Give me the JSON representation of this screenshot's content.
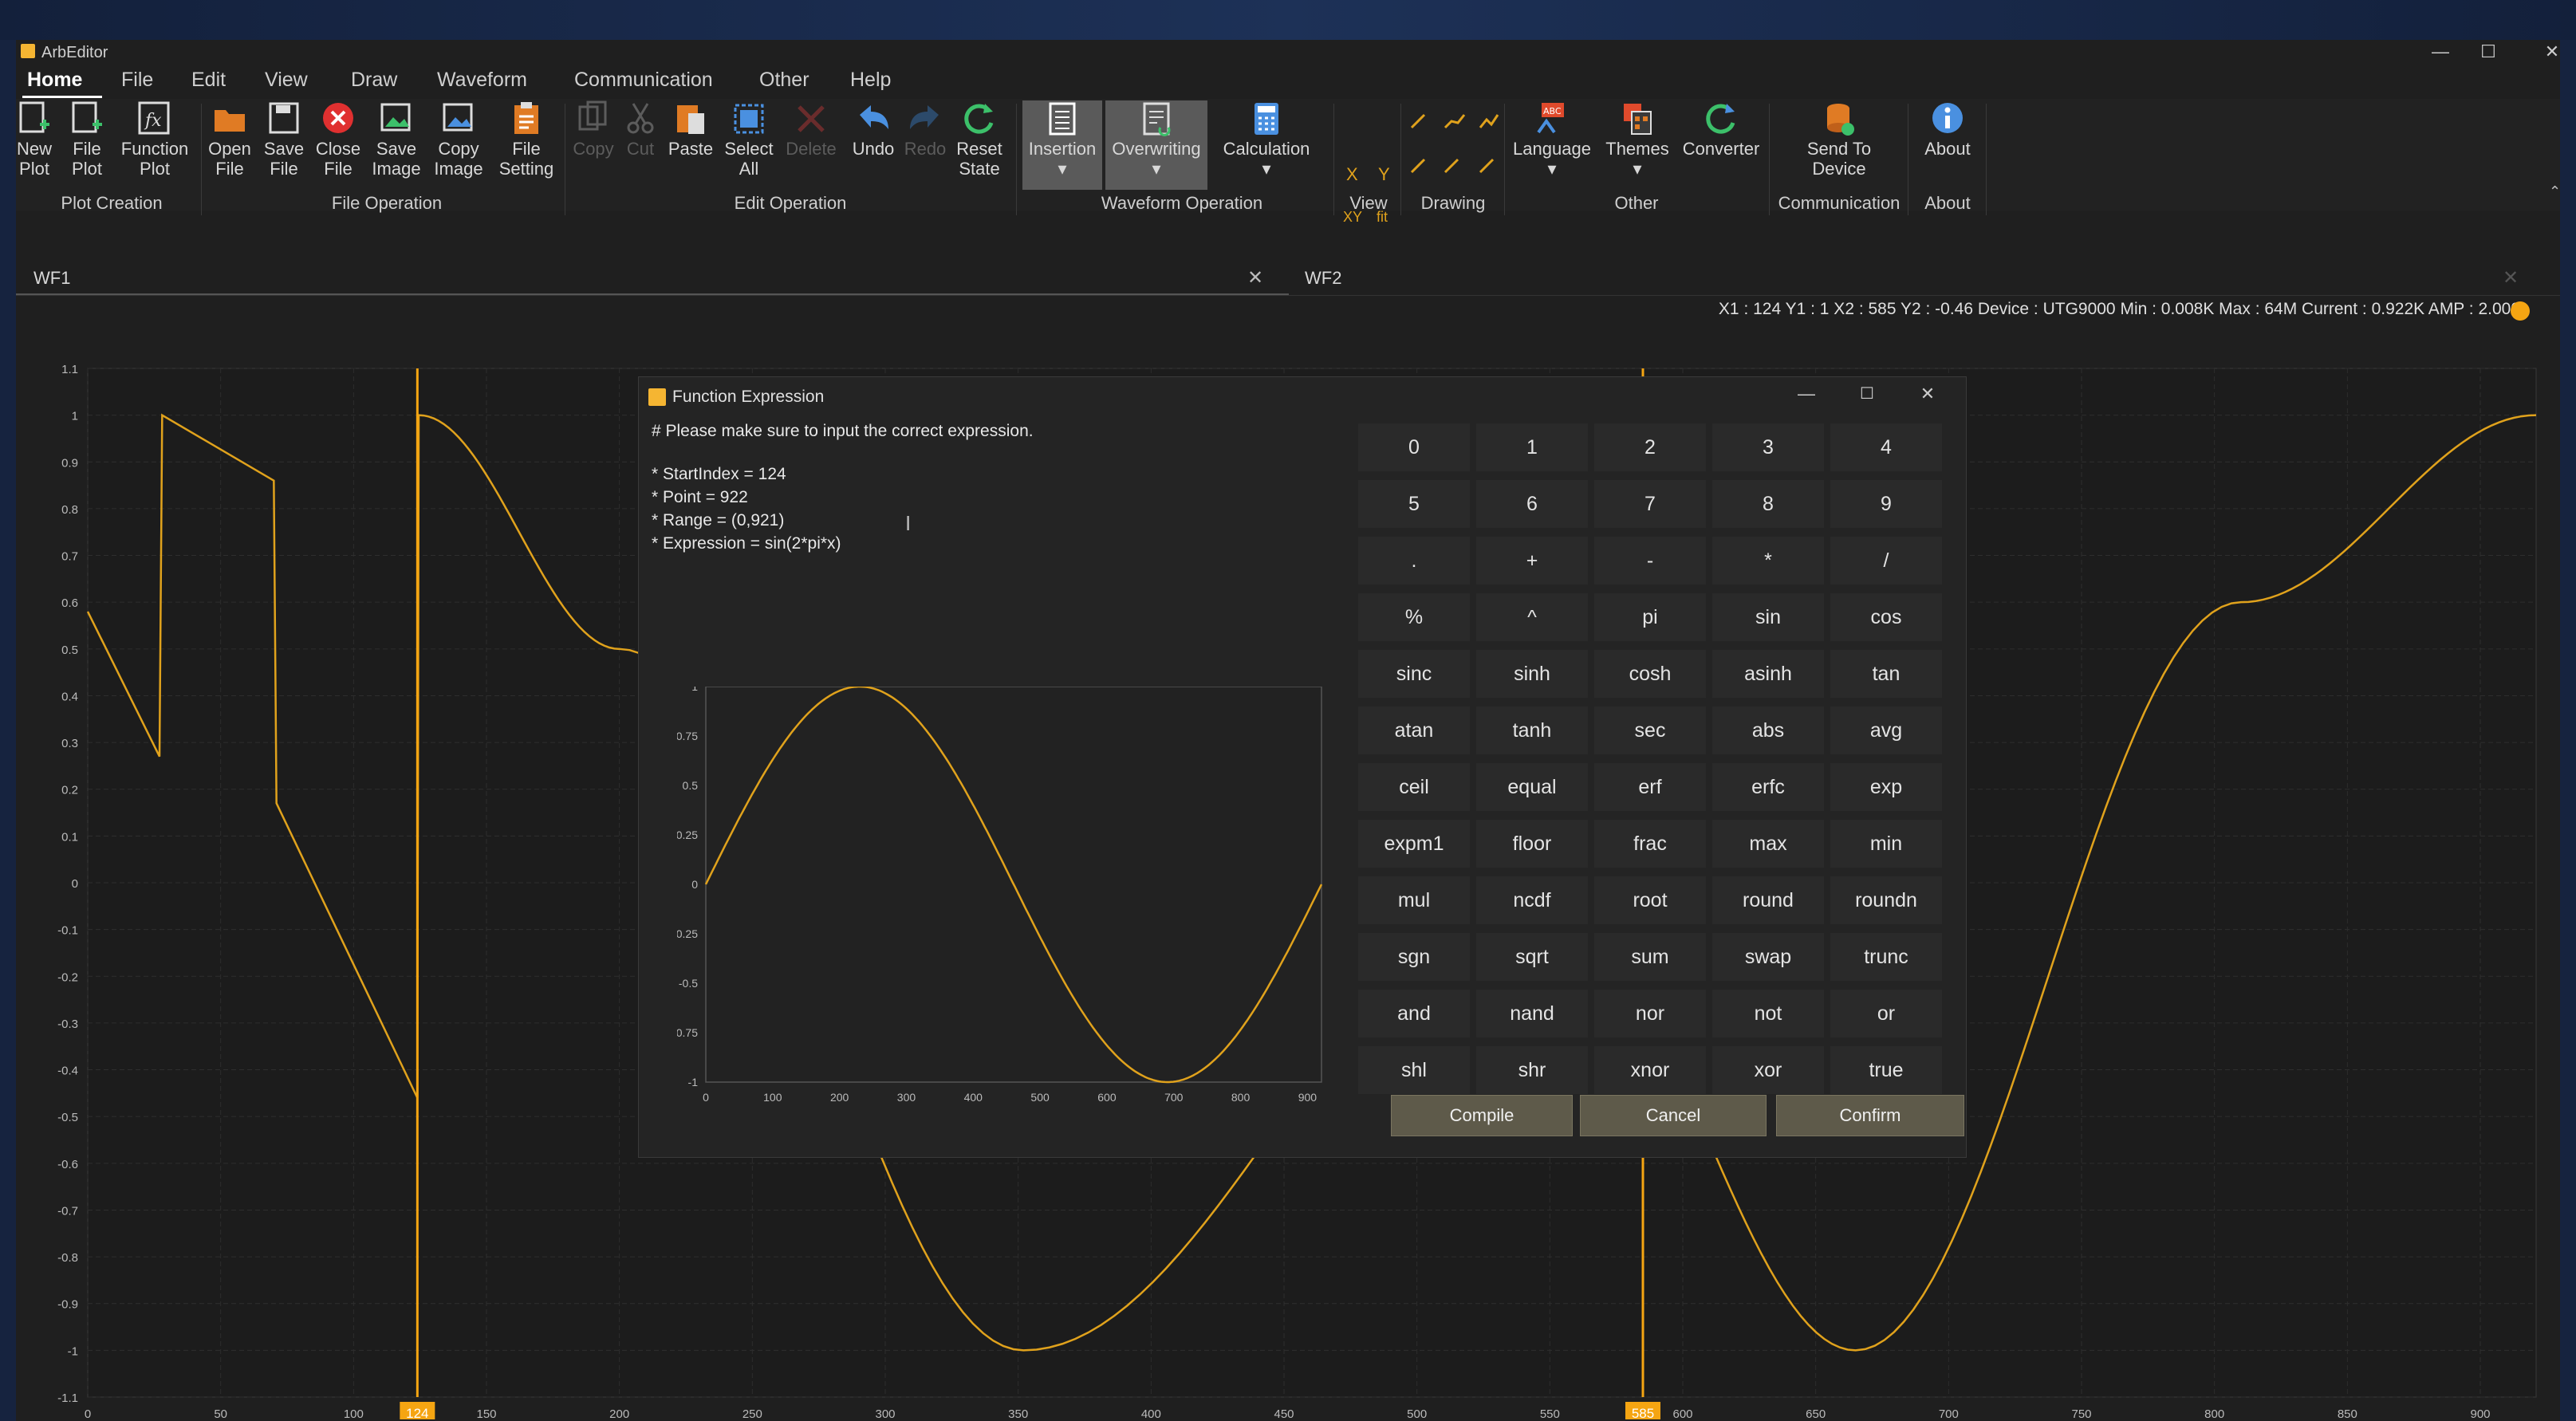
{
  "window": {
    "title": "ArbEditor"
  },
  "menu": [
    "Home",
    "File",
    "Edit",
    "View",
    "Draw",
    "Waveform",
    "Communication",
    "Other",
    "Help"
  ],
  "ribbon": {
    "buttons": [
      {
        "l1": "New",
        "l2": "Plot",
        "icon": "new-plot-icon"
      },
      {
        "l1": "File",
        "l2": "Plot",
        "icon": "file-plot-icon"
      },
      {
        "l1": "Function",
        "l2": "Plot",
        "icon": "function-plot-icon"
      },
      {
        "l1": "Open",
        "l2": "File",
        "icon": "open-folder-icon"
      },
      {
        "l1": "Save",
        "l2": "File",
        "icon": "save-icon"
      },
      {
        "l1": "Close",
        "l2": "File",
        "icon": "close-file-icon"
      },
      {
        "l1": "Save",
        "l2": "Image",
        "icon": "save-image-icon"
      },
      {
        "l1": "Copy",
        "l2": "Image",
        "icon": "copy-image-icon"
      },
      {
        "l1": "File",
        "l2": "Setting",
        "icon": "file-setting-icon"
      },
      {
        "l1": "Copy",
        "l2": "",
        "icon": "copy-icon"
      },
      {
        "l1": "Cut",
        "l2": "",
        "icon": "cut-icon"
      },
      {
        "l1": "Paste",
        "l2": "",
        "icon": "paste-icon"
      },
      {
        "l1": "Select",
        "l2": "All",
        "icon": "select-all-icon"
      },
      {
        "l1": "Delete",
        "l2": "",
        "icon": "delete-icon"
      },
      {
        "l1": "Undo",
        "l2": "",
        "icon": "undo-icon"
      },
      {
        "l1": "Redo",
        "l2": "",
        "icon": "redo-icon"
      },
      {
        "l1": "Reset",
        "l2": "State",
        "icon": "reset-icon"
      },
      {
        "l1": "Insertion",
        "l2": "",
        "icon": "insertion-icon"
      },
      {
        "l1": "Overwriting",
        "l2": "",
        "icon": "overwriting-icon"
      },
      {
        "l1": "Calculation",
        "l2": "",
        "icon": "calculation-icon"
      },
      {
        "l1": "Language",
        "l2": "",
        "icon": "language-icon"
      },
      {
        "l1": "Themes",
        "l2": "",
        "icon": "themes-icon"
      },
      {
        "l1": "Converter",
        "l2": "",
        "icon": "converter-icon"
      },
      {
        "l1": "Send To",
        "l2": "Device",
        "icon": "send-to-device-icon"
      },
      {
        "l1": "About",
        "l2": "",
        "icon": "about-icon"
      }
    ],
    "groups": [
      "Plot Creation",
      "File Operation",
      "Edit Operation",
      "Waveform Operation",
      "View",
      "Drawing",
      "Other",
      "Communication",
      "About"
    ],
    "view_icons": [
      "X",
      "Y",
      "XY",
      "fit"
    ]
  },
  "tabs": [
    {
      "label": "WF1"
    },
    {
      "label": "WF2"
    }
  ],
  "status": "X1 : 124  Y1 : 1  X2 : 585  Y2 : -0.46  Device : UTG9000  Min : 0.008K  Max : 64M  Current : 0.922K  AMP : 2.000",
  "markers": {
    "x1": "124",
    "x2": "585"
  },
  "dialog": {
    "title": "Function Expression",
    "lines": [
      "# Please make sure to input the correct expression.",
      "* StartIndex = 124",
      "* Point = 922",
      "* Range = (0,921)",
      "* Expression = sin(2*pi*x)"
    ],
    "keys": [
      "0",
      "1",
      "2",
      "3",
      "4",
      "5",
      "6",
      "7",
      "8",
      "9",
      ".",
      "+",
      "-",
      "*",
      "/",
      "%",
      "^",
      "pi",
      "sin",
      "cos",
      "sinc",
      "sinh",
      "cosh",
      "asinh",
      "tan",
      "atan",
      "tanh",
      "sec",
      "abs",
      "avg",
      "ceil",
      "equal",
      "erf",
      "erfc",
      "exp",
      "expm1",
      "floor",
      "frac",
      "max",
      "min",
      "mul",
      "ncdf",
      "root",
      "round",
      "roundn",
      "sgn",
      "sqrt",
      "sum",
      "swap",
      "trunc",
      "and",
      "nand",
      "nor",
      "not",
      "or",
      "shl",
      "shr",
      "xnor",
      "xor",
      "true"
    ],
    "buttons": {
      "compile": "Compile",
      "cancel": "Cancel",
      "confirm": "Confirm"
    }
  },
  "colors": {
    "wave": "#e0a21c",
    "marker": "#f5a512",
    "accent": "#f5b532",
    "grid": "#333333"
  },
  "chart_data": [
    {
      "type": "line",
      "title": "",
      "ylim": [
        -1.1,
        1.1
      ],
      "xlim": [
        0,
        921
      ],
      "yticks": [
        "1.1",
        "1",
        "0.9",
        "0.8",
        "0.7",
        "0.6",
        "0.5",
        "0.4",
        "0.3",
        "0.2",
        "0.1",
        "0",
        "-0.1",
        "-0.2",
        "-0.3",
        "-0.4",
        "-0.5",
        "-0.6",
        "-0.7",
        "-0.8",
        "-0.9",
        "-1",
        "-1.1"
      ],
      "xticks": [
        "0",
        "50",
        "100",
        "124",
        "150",
        "200",
        "250",
        "300",
        "350",
        "400",
        "450",
        "500",
        "550",
        "585",
        "600",
        "650",
        "700",
        "750",
        "800",
        "850",
        "900"
      ],
      "grid": true,
      "series": [
        {
          "x": [
            0,
            27,
            28,
            70,
            71,
            124,
            124.5,
            200,
            352,
            547,
            665,
            810,
            921
          ],
          "y": [
            0.58,
            0.27,
            1.0,
            0.86,
            0.17,
            -0.46,
            1.0,
            0.5,
            -1.0,
            0.0,
            -1.0,
            0.6,
            1.0
          ]
        }
      ]
    },
    {
      "type": "line",
      "title": "",
      "ylim": [
        -1,
        1
      ],
      "xlim": [
        0,
        921
      ],
      "yticks": [
        "1",
        "0.75",
        "0.5",
        "0.25",
        "0",
        "-0.25",
        "-0.5",
        "-0.75",
        "-1"
      ],
      "xticks": [
        "0",
        "100",
        "200",
        "300",
        "400",
        "500",
        "600",
        "700",
        "800",
        "900"
      ],
      "grid": false,
      "series": [
        {
          "expression": "sin(2*pi*x)",
          "points": 922
        }
      ]
    }
  ]
}
